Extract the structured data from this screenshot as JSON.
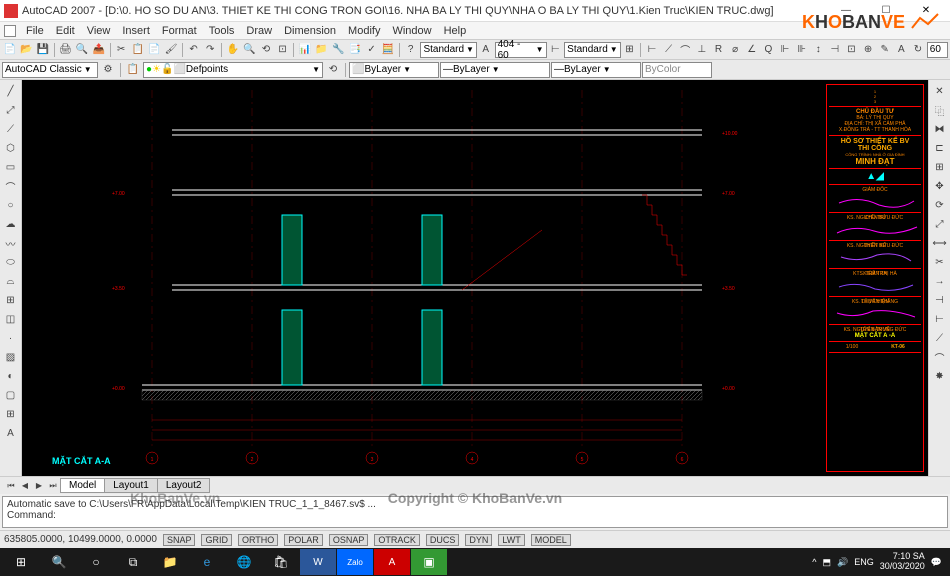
{
  "app": {
    "title": "AutoCAD 2007 - [D:\\0. HO SO DU AN\\3. THIET KE THI CONG TRON GOI\\16. NHA BA LY THI QUY\\NHA O BA LY THI QUY\\1.Kien Truc\\KIEN TRUC.dwg]",
    "name": "AutoCAD 2007"
  },
  "window_controls": {
    "min": "—",
    "max": "☐",
    "close": "✕"
  },
  "menu": {
    "items": [
      "File",
      "Edit",
      "View",
      "Insert",
      "Format",
      "Tools",
      "Draw",
      "Dimension",
      "Modify",
      "Window",
      "Help"
    ]
  },
  "toolbar2": {
    "workspace": "AutoCAD Classic",
    "layer": "Defpoints",
    "style_combo": "Standard",
    "dim_combo": "404 - 60",
    "table_combo": "Standard",
    "spin_value": "60"
  },
  "toolbar3": {
    "color": "ByLayer",
    "linetype": "ByLayer",
    "lineweight": "ByLayer",
    "plotstyle": "ByColor"
  },
  "tabs": {
    "items": [
      "Model",
      "Layout1",
      "Layout2"
    ],
    "active": 0
  },
  "command": {
    "history": "Automatic save to C:\\Users\\FR\\AppData\\Local\\Temp\\KIEN TRUC_1_1_8467.sv$ ...",
    "prompt": "Command:"
  },
  "status": {
    "coords": "635805.0000, 10499.0000, 0.0000",
    "toggles": [
      "SNAP",
      "GRID",
      "ORTHO",
      "POLAR",
      "OSNAP",
      "OTRACK",
      "DUCS",
      "DYN",
      "LWT",
      "MODEL"
    ]
  },
  "taskbar": {
    "time": "7:10 SA",
    "date": "30/03/2020",
    "lang": "ENG",
    "tray_icons": [
      "^",
      "⬒",
      "🔊"
    ]
  },
  "drawing": {
    "section_title": "MẶT CẮT A-A",
    "grid_labels": [
      "1",
      "2",
      "3",
      "4",
      "5",
      "6"
    ],
    "title_block": {
      "header1": "CHỦ ĐẦU TƯ",
      "header2": "BÀ: LÝ THỊ QUY",
      "header3": "ĐỊA CHỈ: THỊ XÃ CẨM PHẢ",
      "header4": "X.ĐÔNG TRÀ - TT THANH HÓA",
      "project": "HỒ SƠ THIẾT KẾ BV",
      "project2": "THI CÔNG",
      "company_sub": "CÔNG TRÌNH: NHÀ Ở GIA ĐÌNH",
      "company": "MINH ĐẠT",
      "role1": "GIÁM ĐỐC",
      "name1": "KS. NGUYỄN BỬU ĐỨC",
      "role2": "CHỦ TRÌ",
      "name2": "KS. NGUYỄN BỬU ĐỨC",
      "role3": "THIẾT KẾ",
      "name3": "KTS. TRẦN THỊ HÀ",
      "role4": "KIỂM TRA",
      "name4": "KS. LÊ VĂN THẮNG",
      "role5": "THỰC HIỆN",
      "name5": "KS. NGUYỄN TRUNG ĐỨC",
      "sheet_label": "TÊN BẢN VẼ",
      "sheet_name": "MẶT CẮT A -A",
      "sheet_no": "KT-06",
      "scale": "1/100"
    }
  },
  "watermark": {
    "logo": "KHOBANVE",
    "center": "Copyright © KhoBanVe.vn",
    "left": "KhoBanVe.vn"
  }
}
